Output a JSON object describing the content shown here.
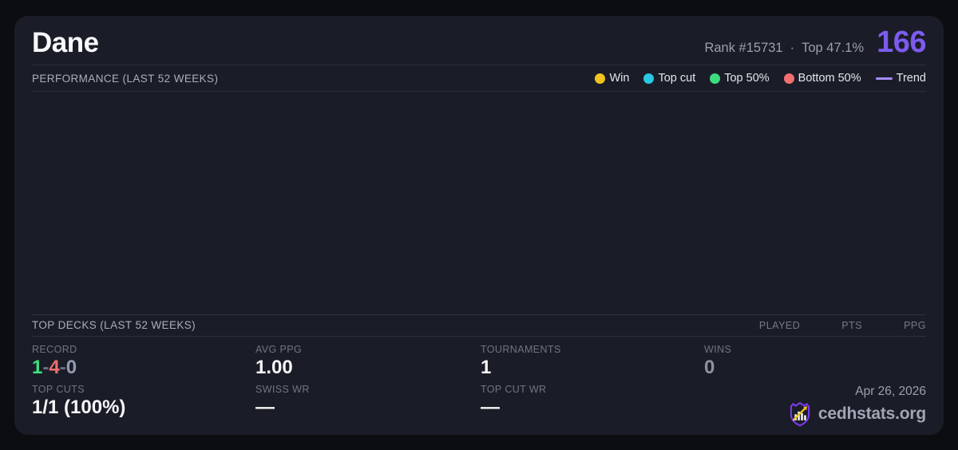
{
  "header": {
    "player_name": "Dane",
    "rank_text": "Rank #15731",
    "separator": "·",
    "top_percent": "Top 47.1%",
    "rating": "166"
  },
  "performance": {
    "title": "PERFORMANCE (LAST 52 WEEKS)",
    "legend": [
      {
        "label": "Win",
        "color": "#f0c420",
        "type": "dot"
      },
      {
        "label": "Top cut",
        "color": "#2bc8e4",
        "type": "dot"
      },
      {
        "label": "Top 50%",
        "color": "#3edc81",
        "type": "dot"
      },
      {
        "label": "Bottom 50%",
        "color": "#f47070",
        "type": "dot"
      },
      {
        "label": "Trend",
        "color": "#a78bfa",
        "type": "line"
      }
    ],
    "chart_data": {
      "type": "scatter",
      "series": [],
      "note": "plot area is empty"
    }
  },
  "top_decks": {
    "title": "TOP DECKS (LAST 52 WEEKS)",
    "columns": [
      "PLAYED",
      "PTS",
      "PPG"
    ],
    "rows": []
  },
  "stats": {
    "record": {
      "label": "RECORD",
      "wins": "1",
      "losses": "4",
      "draws": "0",
      "separator": "-"
    },
    "avg_ppg": {
      "label": "AVG PPG",
      "value": "1.00"
    },
    "tournaments": {
      "label": "TOURNAMENTS",
      "value": "1"
    },
    "wins": {
      "label": "WINS",
      "value": "0"
    },
    "top_cuts": {
      "label": "TOP CUTS",
      "value": "1/1 (100%)"
    },
    "swiss_wr": {
      "label": "SWISS WR",
      "value": "—"
    },
    "top_cut_wr": {
      "label": "TOP CUT WR",
      "value": "—"
    }
  },
  "footer": {
    "date": "Apr 26, 2026",
    "brand": "cedhstats.org"
  },
  "colors": {
    "accent_purple": "#7d5bef",
    "card_background": "#1a1d27",
    "page_background": "#0c0d10",
    "record_win_green": "#3fe081",
    "record_loss_red": "#f06e6e",
    "muted_value_gray": "#8c93a3",
    "logo_shield_purple": "#7c3aed",
    "logo_arrow_gold": "#f0c420"
  }
}
